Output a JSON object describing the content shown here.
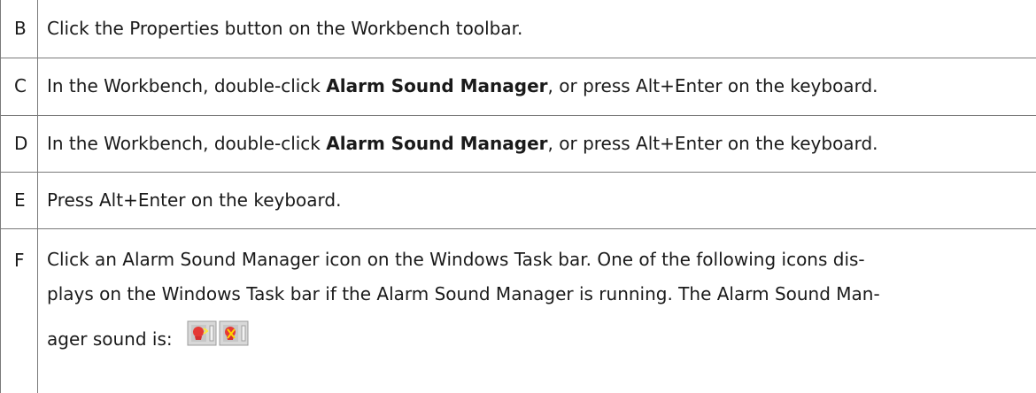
{
  "rows": [
    {
      "letter": "B",
      "text": "Click the Properties button on the Workbench toolbar."
    },
    {
      "letter": "C",
      "before": "In the Workbench, double-click ",
      "bold": "Alarm Sound Manager",
      "after": ", or press Alt+Enter on the keyboard."
    },
    {
      "letter": "D",
      "before": "In the Workbench, double-click ",
      "bold": "Alarm Sound Manager",
      "after": ", or press Alt+Enter on the keyboard."
    },
    {
      "letter": "E",
      "text": "Press Alt+Enter on the keyboard."
    },
    {
      "letter": "F",
      "line1": "Click an Alarm Sound Manager icon on the Windows Task bar. One of the following icons dis-",
      "line2": "plays on the Windows Task bar if the Alarm Sound Manager is running. The Alarm Sound Man-",
      "line3": "ager sound is:",
      "icons": [
        "alarm-sound-manager-icon",
        "alarm-sound-manager-muted-icon"
      ]
    }
  ]
}
